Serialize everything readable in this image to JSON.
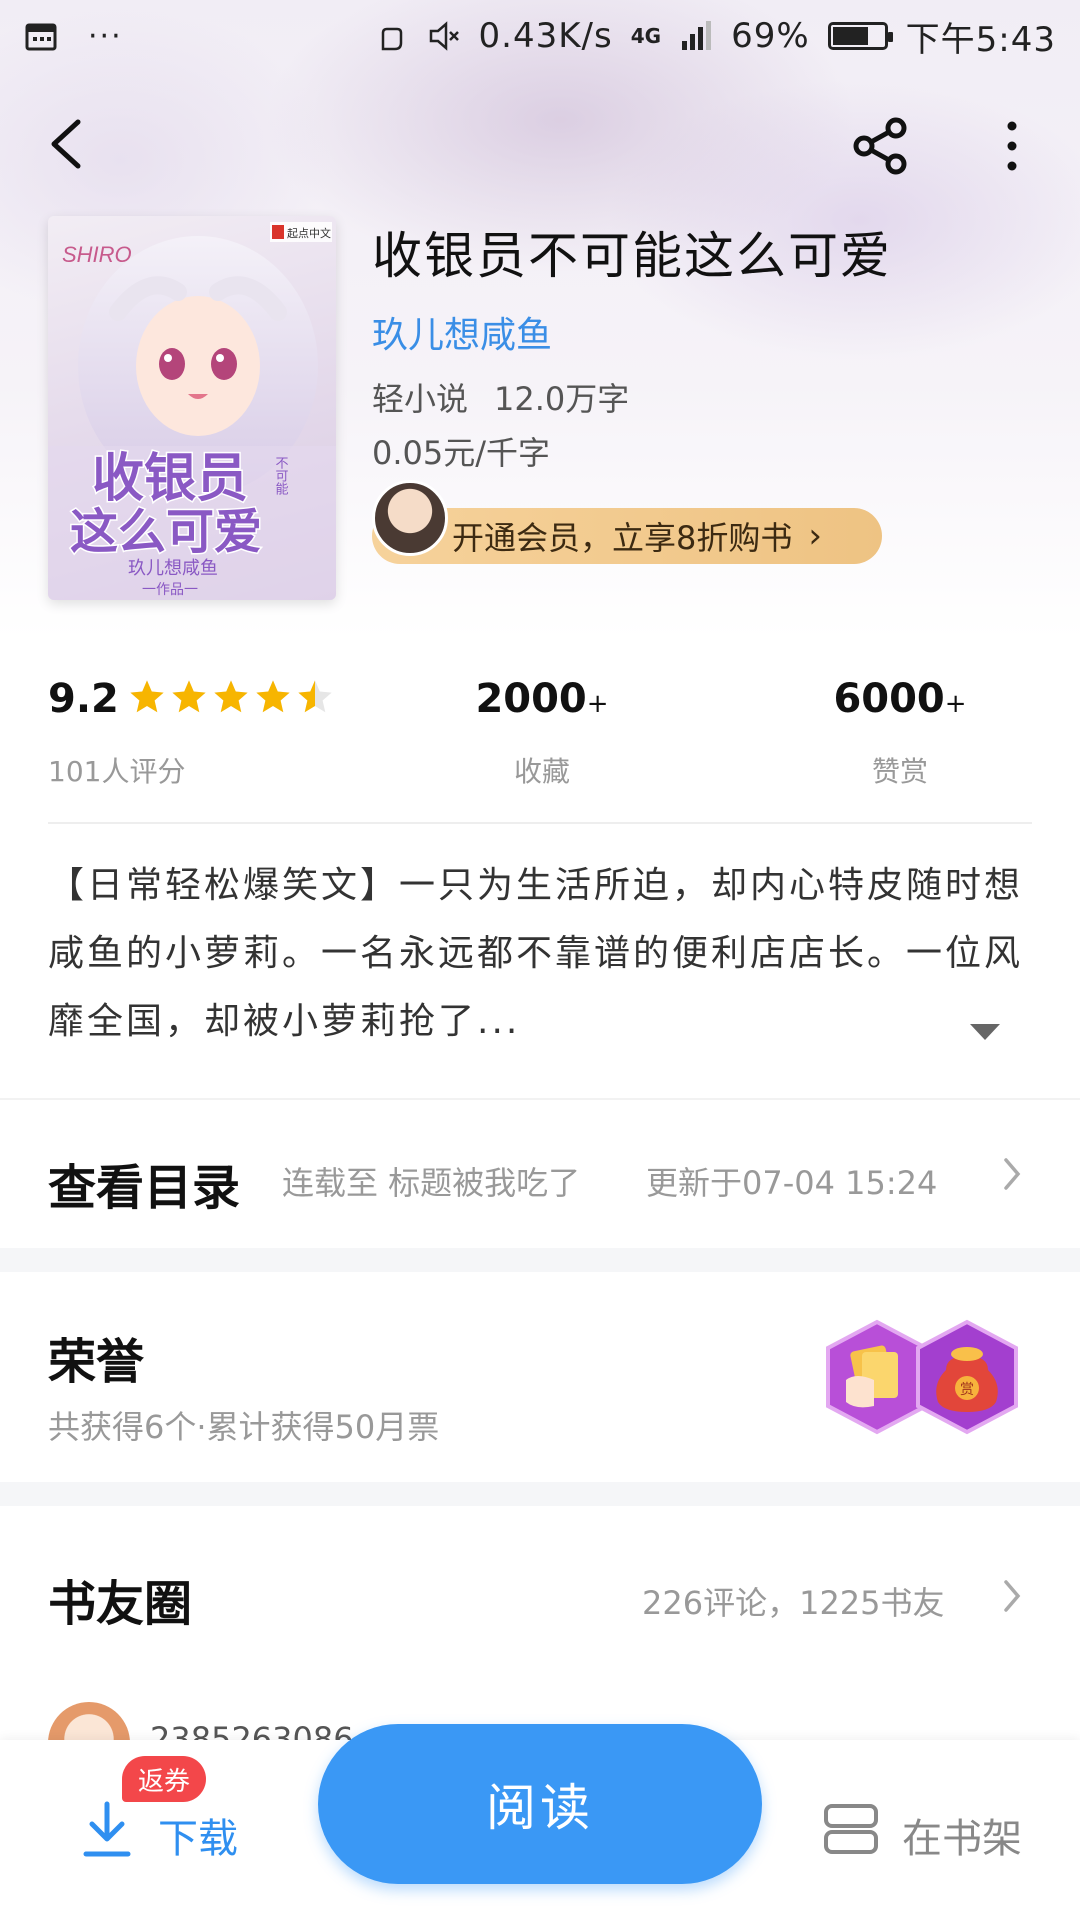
{
  "status_bar": {
    "net_speed": "0.43K/s",
    "network": "4G",
    "battery": "69%",
    "battery_level": 0.69,
    "time": "下午5:43"
  },
  "book": {
    "title": "收银员不可能这么可爱",
    "author": "玖儿想咸鱼",
    "category": "轻小说",
    "word_count": "12.0万字",
    "price": "0.05元/千字",
    "vip_promo": "开通会员，立享8折购书"
  },
  "cover": {
    "badge": "起点中文",
    "art_text_title_1": "收银员",
    "art_text_title_2": "这么可爱",
    "art_text_small": "不可能",
    "art_text_author": "玖儿想咸鱼",
    "art_text_work": "一作品一",
    "art_text_name": "SHIRO"
  },
  "rating": {
    "score": "9.2",
    "stars": 4.5,
    "count_label": "101人评分"
  },
  "stats": {
    "favorites": "2000",
    "favorites_suffix": "+",
    "favorites_label": "收藏",
    "rewards": "6000",
    "rewards_suffix": "+",
    "rewards_label": "赞赏"
  },
  "intro": {
    "text": "【日常轻松爆笑文】一只为生活所迫，却内心特皮随时想咸鱼的小萝莉。一名永远都不靠谱的便利店店长。一位风靡全国，却被小萝莉抢了..."
  },
  "toc": {
    "title": "查看目录",
    "latest": "连载至 标题被我吃了",
    "updated": "更新于07-04 15:24"
  },
  "honor": {
    "title": "荣誉",
    "subtitle": "共获得6个·累计获得50月票",
    "badge_text": "赏"
  },
  "circle": {
    "title": "书友圈",
    "stats": "226评论，1225书友",
    "peek_name": "2385263086"
  },
  "bottom": {
    "download": "下载",
    "coupon": "返券",
    "read": "阅读",
    "shelf": "在书架"
  },
  "colors": {
    "accent": "#3a98f5",
    "author_link": "#3a8ee6",
    "star": "#f7b500",
    "coupon": "#f3474a",
    "vip": "#f6d29b"
  }
}
